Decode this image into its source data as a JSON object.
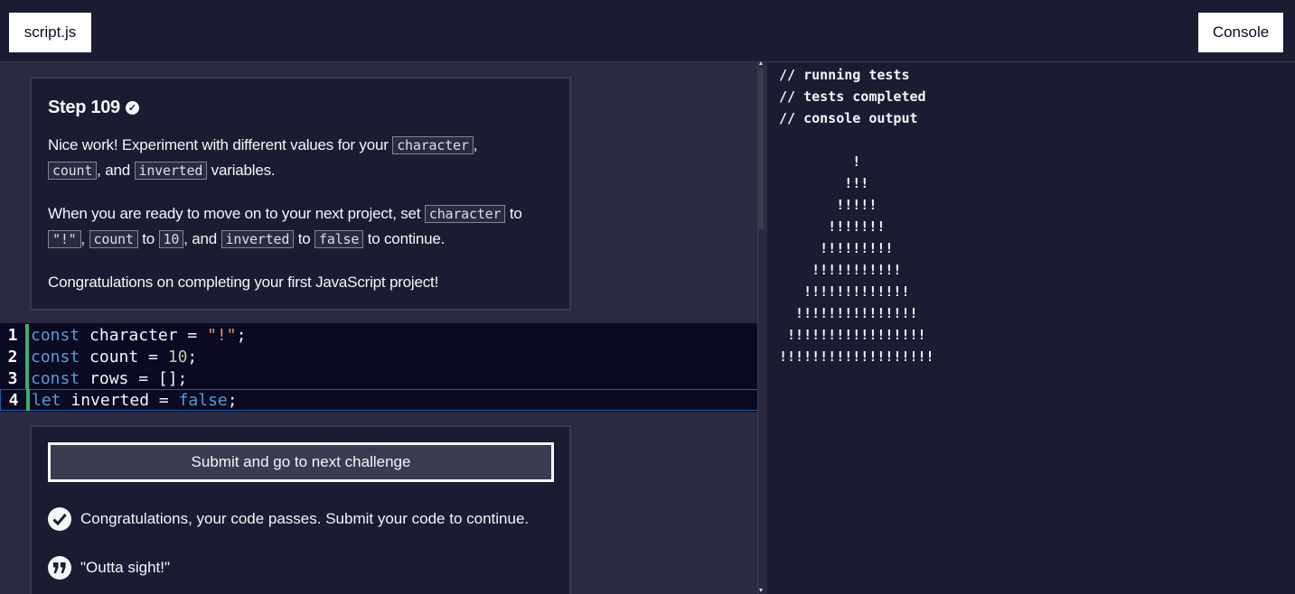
{
  "tabs": {
    "script_label": "script.js",
    "console_label": "Console"
  },
  "description": {
    "step_title": "Step 109",
    "p1_a": "Nice work! Experiment with different values for your ",
    "p1_code1": "character",
    "p1_b": ",",
    "p1_code2": "count",
    "p1_c": ", and ",
    "p1_code3": "inverted",
    "p1_d": " variables.",
    "p2_a": "When you are ready to move on to your next project, set ",
    "p2_code1": "character",
    "p2_b": " to",
    "p2_code2": "\"!\"",
    "p2_c": ", ",
    "p2_code3": "count",
    "p2_d": " to ",
    "p2_code4": "10",
    "p2_e": ", and ",
    "p2_code5": "inverted",
    "p2_f": " to ",
    "p2_code6": "false",
    "p2_g": " to continue.",
    "p3": "Congratulations on completing your first JavaScript project!"
  },
  "editor": {
    "lines": [
      {
        "num": "1",
        "kw": "const",
        "rest_a": " character = ",
        "lit": "\"!\"",
        "rest_b": ";"
      },
      {
        "num": "2",
        "kw": "const",
        "rest_a": " count = ",
        "lit": "10",
        "rest_b": ";"
      },
      {
        "num": "3",
        "kw": "const",
        "rest_a": " rows = [];",
        "lit": "",
        "rest_b": ""
      },
      {
        "num": "4",
        "kw": "let",
        "rest_a": " inverted = ",
        "lit": "false",
        "rest_b": ";"
      }
    ]
  },
  "result": {
    "submit_label": "Submit and go to next challenge",
    "pass_message": "Congratulations, your code passes. Submit your code to continue.",
    "quote": "\"Outta sight!\""
  },
  "console": {
    "lines": [
      "// running tests",
      "// tests completed",
      "// console output",
      "",
      "         !",
      "        !!!",
      "       !!!!!",
      "      !!!!!!!",
      "     !!!!!!!!!",
      "    !!!!!!!!!!!",
      "   !!!!!!!!!!!!!",
      "  !!!!!!!!!!!!!!!",
      " !!!!!!!!!!!!!!!!!",
      "!!!!!!!!!!!!!!!!!!!"
    ]
  },
  "icons": {
    "step_check": "check-circle-icon",
    "pass_check": "check-circle-icon",
    "quote": "quote-icon"
  }
}
